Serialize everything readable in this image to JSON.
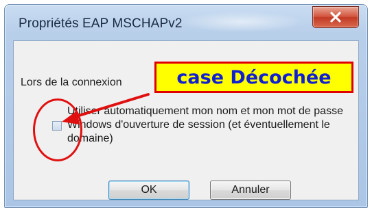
{
  "window": {
    "title": "Propriétés EAP MSCHAPv2",
    "close_label": "X"
  },
  "dialog": {
    "connexion_label": "Lors de la connexion",
    "checkbox_label": "Utiliser automatiquement mon nom et mon mot de passe Windows d'ouverture de session (et éventuellement le domaine)",
    "checkbox_checked": false
  },
  "annotation": {
    "callout_text": "case Décochée",
    "callout_bg": "#ffff00",
    "callout_border": "#e00000",
    "callout_text_color": "#1020d0",
    "marker_color": "#e01010"
  },
  "buttons": {
    "ok_label": "OK",
    "cancel_label": "Annuler"
  }
}
